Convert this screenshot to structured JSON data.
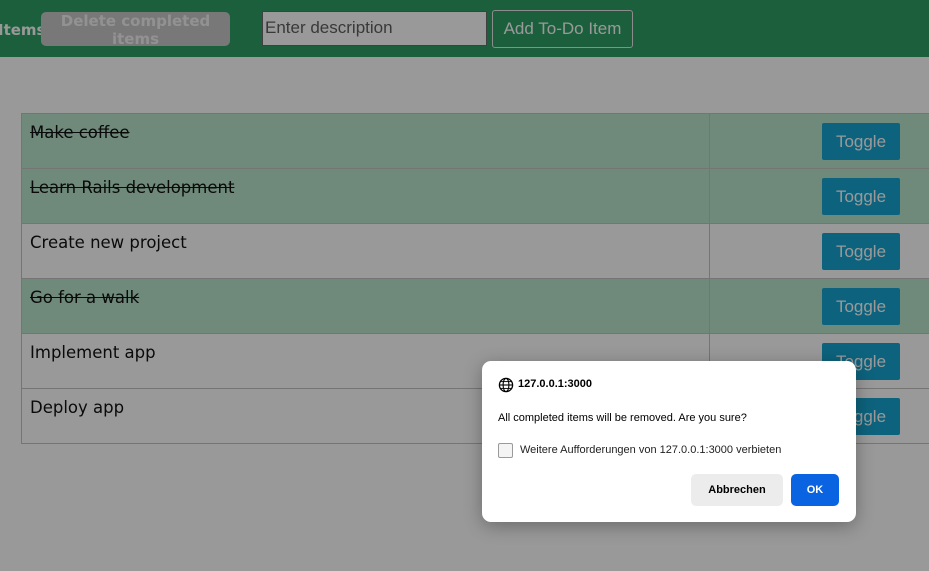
{
  "toolbar": {
    "partial_label": "Items",
    "delete_completed_label": "Delete completed items",
    "description_placeholder": "Enter description",
    "add_label": "Add To-Do Item"
  },
  "todos": [
    {
      "description": "Make coffee",
      "completed": true,
      "toggle_label": "Toggle"
    },
    {
      "description": "Learn Rails development",
      "completed": true,
      "toggle_label": "Toggle"
    },
    {
      "description": "Create new project",
      "completed": false,
      "toggle_label": "Toggle"
    },
    {
      "description": "Go for a walk",
      "completed": true,
      "toggle_label": "Toggle"
    },
    {
      "description": "Implement app",
      "completed": false,
      "toggle_label": "Toggle"
    },
    {
      "description": "Deploy app",
      "completed": false,
      "toggle_label": "Toggle"
    }
  ],
  "dialog": {
    "origin": "127.0.0.1:3000",
    "icon": "globe-icon",
    "message": "All completed items will be removed. Are you sure?",
    "checkbox_label": "Weitere Aufforderungen von 127.0.0.1:3000 verbieten",
    "checkbox_checked": false,
    "cancel_label": "Abbrechen",
    "ok_label": "OK"
  },
  "colors": {
    "header_bg": "#2f9e65",
    "completed_row_bg": "#b9e6ce",
    "toggle_button": "#17a5d1",
    "ok_button": "#0a63e0"
  }
}
